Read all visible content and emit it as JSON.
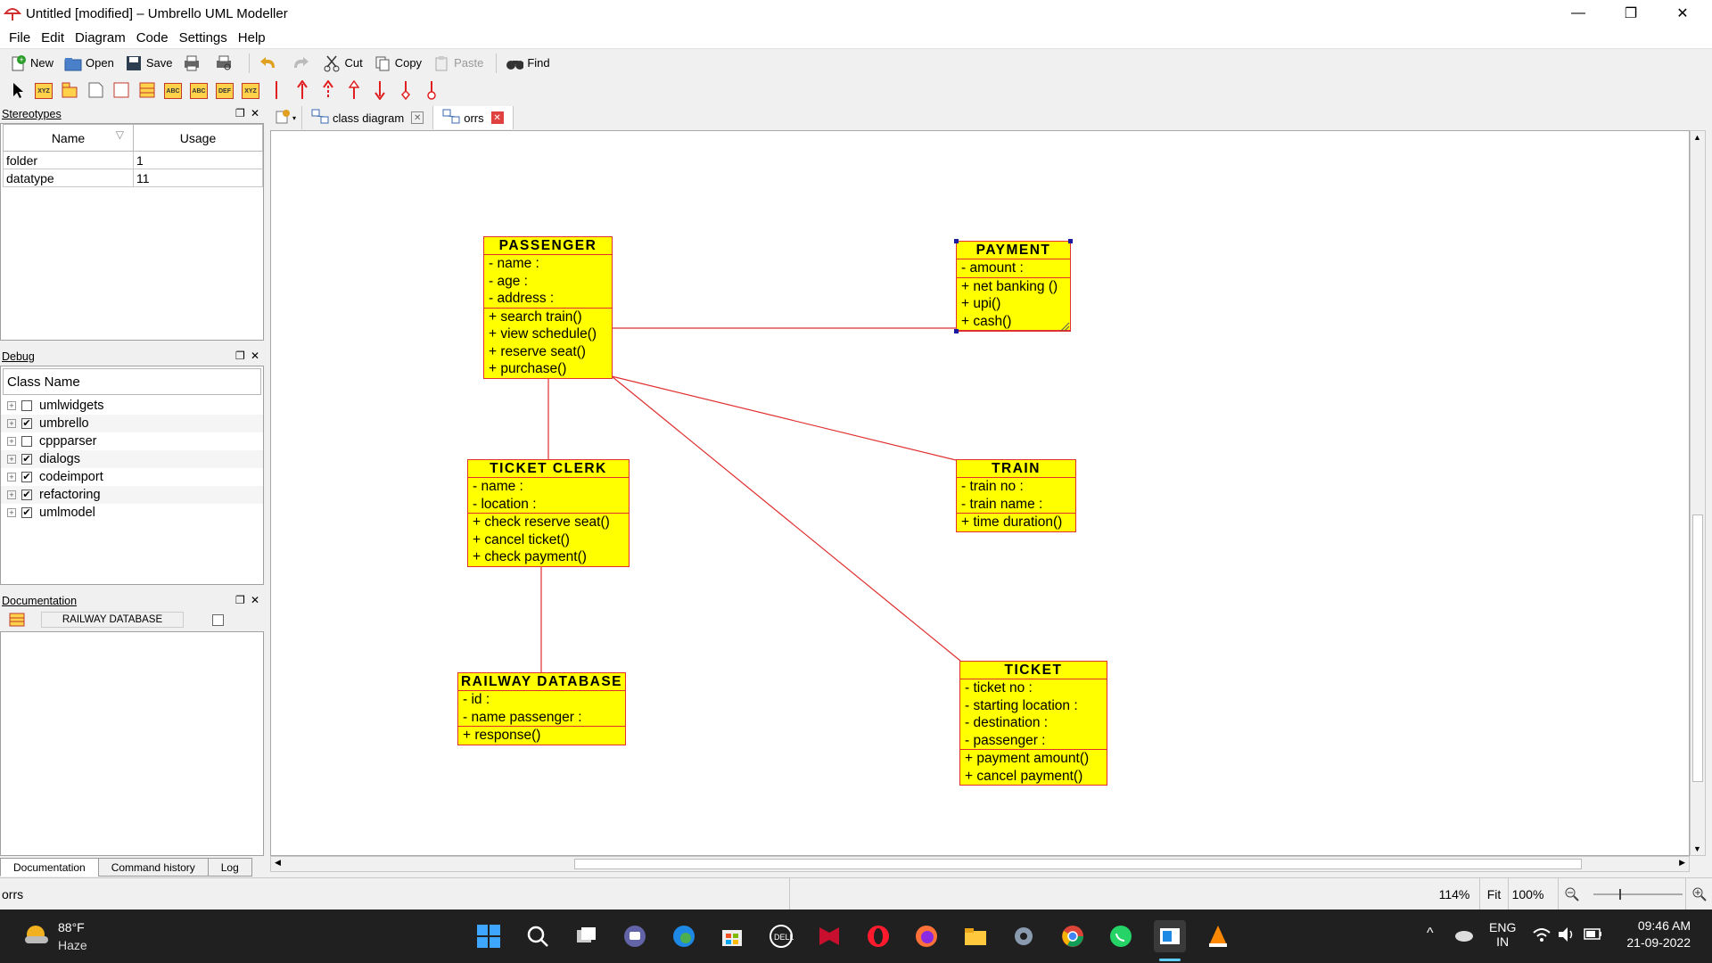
{
  "window": {
    "title": "Untitled [modified] – Umbrello UML Modeller",
    "controls": [
      "—",
      "❐",
      "✕"
    ]
  },
  "menu": [
    "File",
    "Edit",
    "Diagram",
    "Code",
    "Settings",
    "Help"
  ],
  "toolbar": {
    "new": "New",
    "open": "Open",
    "save": "Save",
    "cut": "Cut",
    "copy": "Copy",
    "paste": "Paste",
    "find": "Find"
  },
  "stereotypes": {
    "title": "Stereotypes",
    "col_name": "Name",
    "col_usage": "Usage",
    "rows": [
      {
        "name": "folder",
        "usage": "1"
      },
      {
        "name": "datatype",
        "usage": "11"
      }
    ]
  },
  "debug": {
    "title": "Debug",
    "header": "Class Name",
    "items": [
      {
        "label": "umlwidgets",
        "checked": false
      },
      {
        "label": "umbrello",
        "checked": true
      },
      {
        "label": "cppparser",
        "checked": false
      },
      {
        "label": "dialogs",
        "checked": true
      },
      {
        "label": "codeimport",
        "checked": true
      },
      {
        "label": "refactoring",
        "checked": true
      },
      {
        "label": "umlmodel",
        "checked": true
      }
    ]
  },
  "documentation": {
    "title": "Documentation",
    "field": "RAILWAY DATABASE"
  },
  "left_tabs": [
    "Documentation",
    "Command history",
    "Log"
  ],
  "diagram_tabs": [
    {
      "label": "class diagram",
      "active": false
    },
    {
      "label": "orrs",
      "active": true
    }
  ],
  "classes": {
    "passenger": {
      "name": "PASSENGER",
      "attributes": [
        "- name :",
        "- age :",
        "- address :"
      ],
      "operations": [
        "+ search train()",
        "+ view schedule()",
        "+ reserve seat()",
        "+ purchase()"
      ]
    },
    "payment": {
      "name": "PAYMENT",
      "attributes": [
        "- amount :"
      ],
      "operations": [
        "+ net banking ()",
        "+ upi()",
        "+ cash()"
      ]
    },
    "ticket_clerk": {
      "name": "TICKET CLERK",
      "attributes": [
        "- name :",
        "- location :"
      ],
      "operations": [
        "+ check reserve seat()",
        "+ cancel ticket()",
        "+ check payment()"
      ]
    },
    "train": {
      "name": "TRAIN",
      "attributes": [
        "- train no :",
        "- train name :"
      ],
      "operations": [
        "+ time duration()"
      ]
    },
    "railway_database": {
      "name": "RAILWAY DATABASE",
      "attributes": [
        "- id :",
        "- name passenger :"
      ],
      "operations": [
        "+ response()"
      ]
    },
    "ticket": {
      "name": "TICKET",
      "attributes": [
        "- ticket no :",
        "- starting location :",
        "- destination :",
        "- passenger :"
      ],
      "operations": [
        "+ payment amount()",
        "+ cancel payment()"
      ]
    }
  },
  "status": {
    "left": "orrs",
    "zoom": "114%",
    "fit": "Fit",
    "hundred": "100%"
  },
  "taskbar": {
    "temp": "88°F",
    "weather": "Haze",
    "lang1": "ENG",
    "lang2": "IN",
    "time": "09:46 AM",
    "date": "21-09-2022"
  },
  "colors": {
    "class_fill": "#ffff00",
    "class_border": "#e03030",
    "line": "#e03030"
  }
}
